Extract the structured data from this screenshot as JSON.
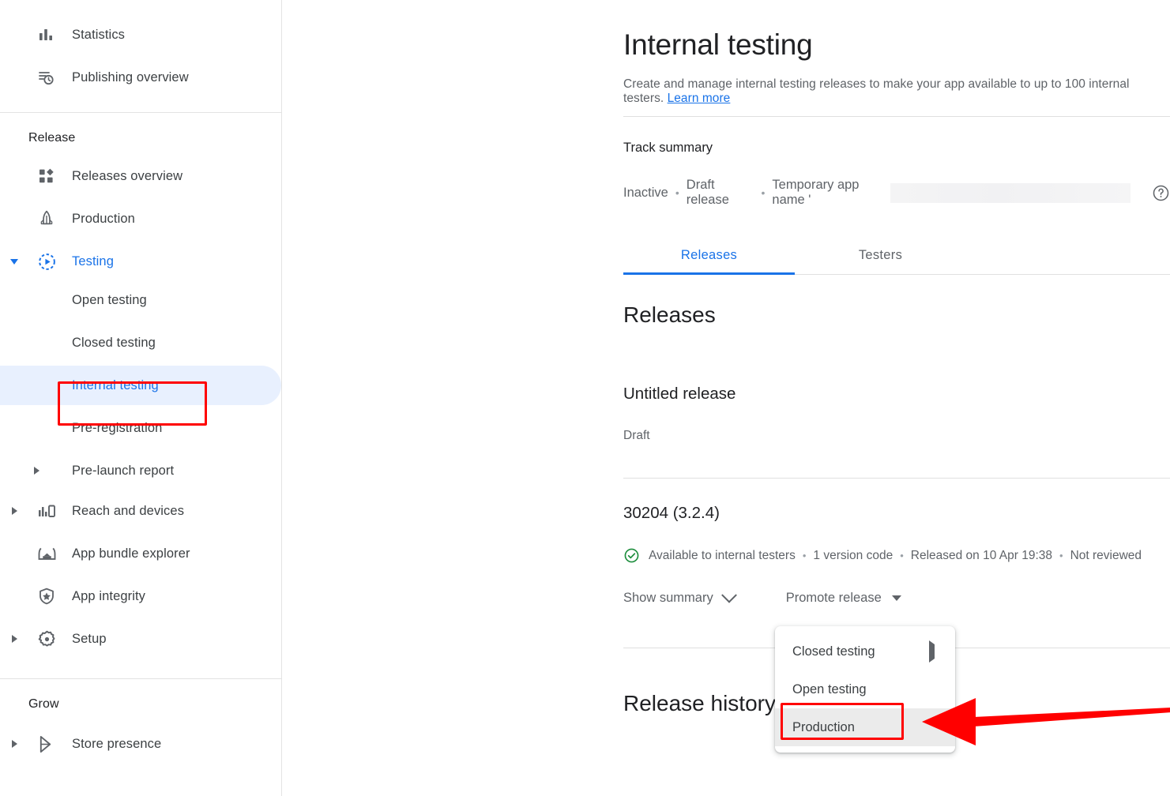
{
  "sidebar": {
    "top_items": [
      {
        "label": "Statistics",
        "icon": "bar-chart-icon"
      },
      {
        "label": "Publishing overview",
        "icon": "publishing-clock-icon"
      }
    ],
    "release_heading": "Release",
    "release_items": [
      {
        "label": "Releases overview",
        "icon": "releases-overview-icon"
      },
      {
        "label": "Production",
        "icon": "rocket-icon"
      },
      {
        "label": "Testing",
        "icon": "testing-play-icon",
        "expanded": true
      },
      {
        "label": "Open testing"
      },
      {
        "label": "Closed testing"
      },
      {
        "label": "Internal testing",
        "selected": true
      },
      {
        "label": "Pre-registration"
      },
      {
        "label": "Pre-launch report",
        "collapsible": true
      },
      {
        "label": "Reach and devices",
        "icon": "reach-devices-icon",
        "collapsible": true
      },
      {
        "label": "App bundle explorer",
        "icon": "android-bundle-icon"
      },
      {
        "label": "App integrity",
        "icon": "shield-star-icon"
      },
      {
        "label": "Setup",
        "icon": "gear-icon",
        "collapsible": true
      }
    ],
    "grow_heading": "Grow",
    "grow_items": [
      {
        "label": "Store presence",
        "icon": "play-store-icon",
        "collapsible": true
      }
    ]
  },
  "page": {
    "title": "Internal testing",
    "subtitle": "Create and manage internal testing releases to make your app available to up to 100 internal testers.",
    "learn_more": "Learn more"
  },
  "track_summary": {
    "heading": "Track summary",
    "status": "Inactive",
    "release_state": "Draft release",
    "app_name_prefix": "Temporary app name '",
    "app_name_redacted": "",
    "help_icon": "help-circle-icon",
    "separator": "•"
  },
  "tabs": [
    {
      "label": "Releases",
      "active": true
    },
    {
      "label": "Testers",
      "active": false
    }
  ],
  "releases": {
    "section_title": "Releases",
    "draft": {
      "name": "Untitled release",
      "status": "Draft"
    },
    "published": {
      "name": "30204 (3.2.4)",
      "status_icon": "check-circle-icon",
      "availability": "Available to internal testers",
      "version_codes": "1 version code",
      "released_on": "Released on 10 Apr 19:38",
      "review_status": "Not reviewed",
      "separator": "•"
    },
    "actions": {
      "show_summary": "Show summary",
      "promote_release": "Promote release"
    }
  },
  "promote_menu": {
    "items": [
      {
        "label": "Closed testing",
        "has_submenu": true,
        "hovered": false
      },
      {
        "label": "Open testing",
        "has_submenu": false,
        "hovered": false
      },
      {
        "label": "Production",
        "has_submenu": false,
        "hovered": true
      }
    ]
  },
  "release_history": {
    "title": "Release history"
  },
  "colors": {
    "accent_blue": "#1a73e8",
    "selected_pill": "#e8f0fe",
    "annotation_red": "#ff0000",
    "success_green": "#1e8e3e",
    "text_primary": "#202124",
    "text_secondary": "#5f6368"
  }
}
